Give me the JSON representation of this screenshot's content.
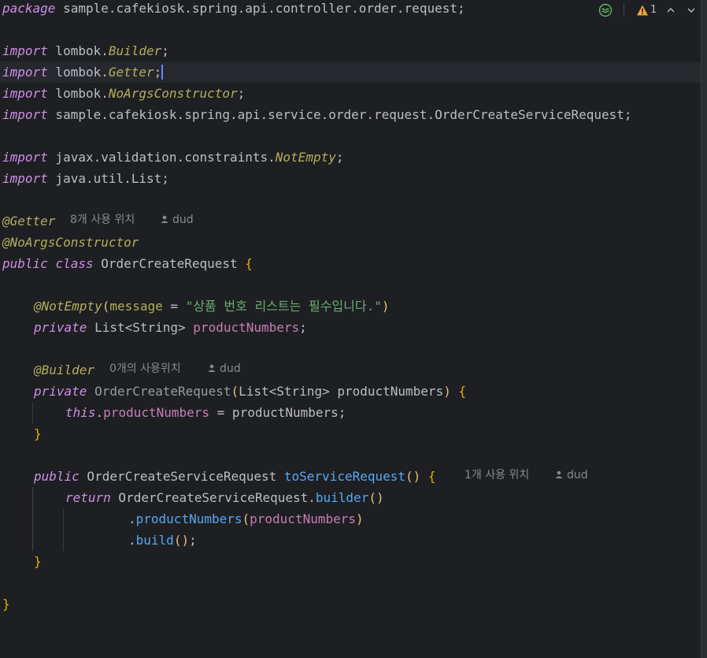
{
  "editor": {
    "lines": {
      "l1": {
        "kw": "package",
        "rest": " sample.cafekiosk.spring.api.controller.order.request;"
      },
      "l3": {
        "kw": "import",
        "pkg": " lombok.",
        "cls": "Builder",
        "end": ";"
      },
      "l4": {
        "kw": "import",
        "pkg": " lombok.",
        "cls": "Getter",
        "end": ";"
      },
      "l5": {
        "kw": "import",
        "pkg": " lombok.",
        "cls": "NoArgsConstructor",
        "end": ";"
      },
      "l6": {
        "kw": "import",
        "rest": " sample.cafekiosk.spring.api.service.order.request.OrderCreateServiceRequest;"
      },
      "l8": {
        "kw": "import",
        "pkg": " javax.validation.constraints.",
        "cls": "NotEmpty",
        "end": ";"
      },
      "l9": {
        "kw": "import",
        "rest": " java.util.List;"
      },
      "l11": {
        "ann": "@Getter"
      },
      "l12": {
        "ann": "@NoArgsConstructor"
      },
      "l13": {
        "kw1": "public",
        "kw2": "class",
        "name": "OrderCreateRequest",
        "brace": "{"
      },
      "l15": {
        "ann": "@NotEmpty",
        "open": "(",
        "param": "message",
        "eq": " = ",
        "str": "\"상품 번호 리스트는 필수입니다.\"",
        "close": ")"
      },
      "l16": {
        "kw": "private",
        "type": " List<String> ",
        "field": "productNumbers",
        "end": ";"
      },
      "l18": {
        "ann": "@Builder"
      },
      "l19": {
        "kw": "private",
        "name": " OrderCreateRequest",
        "open": "(",
        "params": "List<String> productNumbers",
        "close": ")",
        "brace": " {"
      },
      "l20": {
        "kw": "this",
        "dot": ".",
        "field": "productNumbers",
        "rest": " = productNumbers;"
      },
      "l21": {
        "brace": "}"
      },
      "l23": {
        "kw": "public",
        "type": " OrderCreateServiceRequest ",
        "fn": "toServiceRequest",
        "parens": "()",
        "brace": " {"
      },
      "l24": {
        "kw": "return",
        "rest": " OrderCreateServiceRequest.",
        "fn": "builder",
        "parens": "()"
      },
      "l25": {
        "dot": ".",
        "fn": "productNumbers",
        "open": "(",
        "field": "productNumbers",
        "close": ")"
      },
      "l26": {
        "dot": ".",
        "fn": "build",
        "parens": "()",
        "end": ";"
      },
      "l27": {
        "brace": "}"
      },
      "l29": {
        "brace": "}"
      }
    },
    "hints": {
      "getter_usages": "8개 사용 위치",
      "getter_author": "dud",
      "builder_usages": "0개의 사용위치",
      "builder_author": "dud",
      "method_usages": "1개 사용 위치",
      "method_author": "dud"
    },
    "status": {
      "warning_count": "1"
    }
  }
}
